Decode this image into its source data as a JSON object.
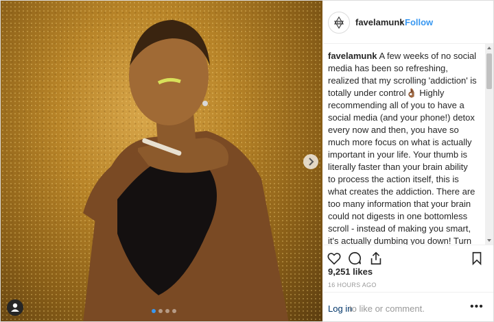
{
  "post": {
    "username": "favelamunk",
    "separator": "•",
    "follow_label": "Follow",
    "caption_user": "favelamunk",
    "caption_text": " A few weeks of no social media has been so refreshing, realized that my scrolling 'addiction' is totally under control👌🏾 Highly recommending all of you to have a social media (and your phone!) detox every now and then, you have so much more focus on what is actually important in your life. Your thumb is literally faster than your brain ability to process the action itself, this is what creates the addiction. There are too many information that your brain could not digests in one bottomless scroll - instead of making you smart, it's actually dumbing you down! Turn off all notifications to have less distarction and shifts the apps position on your phone screen, it breaks down the muscle memory, therefore it stops the routine right there, and you actually use your",
    "likes": "9,251 likes",
    "time": "16 HOURS AGO",
    "login_label": "Log in",
    "comment_prompt": " to like or comment.",
    "more_label": "•••"
  },
  "carousel": {
    "count": 4,
    "active_index": 0
  },
  "icons": {
    "avatar": "logo-mandala-icon",
    "like": "heart-icon",
    "comment": "comment-icon",
    "share": "share-icon",
    "save": "bookmark-icon",
    "next": "chevron-right-icon",
    "tag": "user-tag-icon"
  },
  "colors": {
    "link": "#3897f0",
    "login": "#003569",
    "muted": "#999999",
    "active_dot": "#3897f0"
  }
}
